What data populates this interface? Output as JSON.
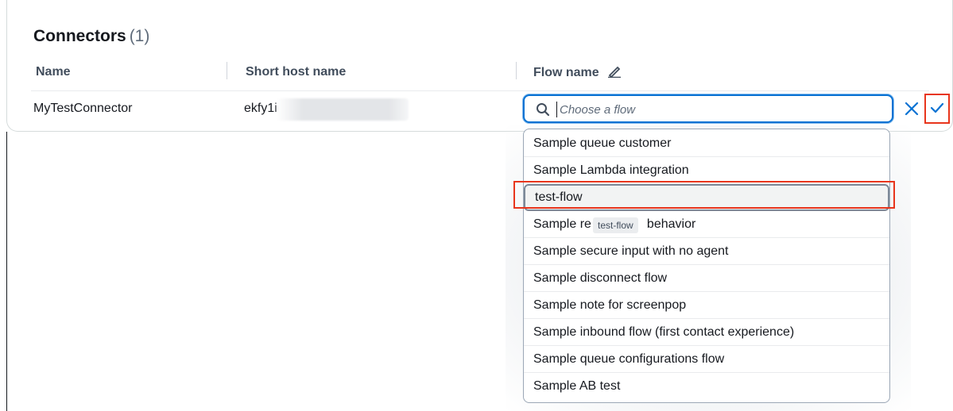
{
  "panel": {
    "title": "Connectors",
    "count": "(1)"
  },
  "columns": {
    "name": "Name",
    "short_host_name": "Short host name",
    "flow_name": "Flow name"
  },
  "row": {
    "name": "MyTestConnector",
    "short_host_name": "ekfy1iq"
  },
  "search": {
    "placeholder": "Choose a flow",
    "value": ""
  },
  "flow_options": [
    "Sample queue customer",
    "Sample Lambda integration",
    "test-flow",
    "Sample re",
    "Sample secure input with no agent",
    "Sample disconnect flow",
    "Sample note for screenpop",
    "Sample inbound flow (first contact experience)",
    "Sample queue configurations flow",
    "Sample AB test"
  ],
  "obscured_option_tail": "behavior",
  "tooltip": "test-flow",
  "icons": {
    "search": "search-icon",
    "edit": "pencil-icon",
    "cancel": "close-icon",
    "confirm": "checkmark-icon"
  },
  "colors": {
    "accent": "#0972d3",
    "annotation": "#e8351c"
  }
}
